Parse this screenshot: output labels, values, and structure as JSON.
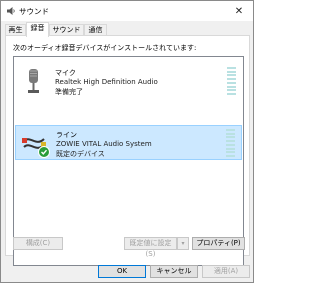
{
  "window": {
    "title": "サウンド",
    "close_label": "✕"
  },
  "tabs": [
    {
      "label": "再生"
    },
    {
      "label": "録音",
      "active": true
    },
    {
      "label": "サウンド"
    },
    {
      "label": "通信"
    }
  ],
  "panel": {
    "instruction": "次のオーディオ録音デバイスがインストールされています:"
  },
  "devices": [
    {
      "name": "マイク",
      "description": "Realtek High Definition Audio",
      "status": "準備完了",
      "icon": "microphone-icon",
      "selected": false
    },
    {
      "name": "ライン",
      "description": "ZOWIE VITAL Audio System",
      "status": "既定のデバイス",
      "icon": "line-in-cable-icon",
      "selected": true,
      "default": true
    }
  ],
  "buttons": {
    "configure": "構成(C)",
    "set_default": "既定値に設定(S)",
    "properties": "プロパティ(P)",
    "ok": "OK",
    "cancel": "キャンセル",
    "apply": "適用(A)"
  },
  "colors": {
    "selection_bg": "#cce8ff",
    "selection_border": "#99d1ff",
    "meter": "#b9e1e2",
    "default_check": "#2a9d3a"
  }
}
